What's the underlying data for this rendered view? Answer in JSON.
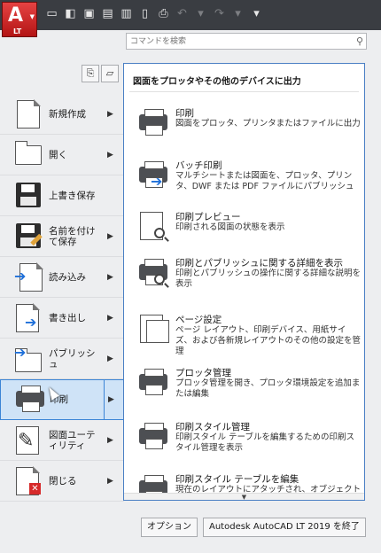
{
  "app": {
    "badge": "LT",
    "letter": "A"
  },
  "search": {
    "placeholder": "コマンドを検索"
  },
  "qat_icons": [
    "new-icon",
    "open-icon",
    "save-icon",
    "saveas-icon",
    "import-icon",
    "mobile-icon",
    "print-icon",
    "undo-icon",
    "redo-icon",
    "dropdown-icon"
  ],
  "left_menu": [
    {
      "label": "新規作成",
      "has_arrow": true
    },
    {
      "label": "開く",
      "has_arrow": true
    },
    {
      "label": "上書き保存",
      "has_arrow": false
    },
    {
      "label": "名前を付けて保存",
      "has_arrow": true
    },
    {
      "label": "読み込み",
      "has_arrow": true
    },
    {
      "label": "書き出し",
      "has_arrow": true
    },
    {
      "label": "パブリッシュ",
      "has_arrow": true
    },
    {
      "label": "印刷",
      "has_arrow": true,
      "active": true
    },
    {
      "label": "図面ユーティリティ",
      "has_arrow": true
    },
    {
      "label": "閉じる",
      "has_arrow": true
    }
  ],
  "submenu": {
    "header": "図面をプロッタやその他のデバイスに出力",
    "items": [
      {
        "title": "印刷",
        "desc": "図面をプロッタ、プリンタまたはファイルに出力"
      },
      {
        "title": "バッチ印刷",
        "desc": "マルチシートまたは図面を、プロッタ、プリンタ、DWF または PDF ファイルにパブリッシュ"
      },
      {
        "title": "印刷プレビュー",
        "desc": "印刷される図面の状態を表示"
      },
      {
        "title": "印刷とパブリッシュに関する詳細を表示",
        "desc": "印刷とパブリッシュの操作に関する詳細な説明を表示"
      },
      {
        "title": "ページ設定",
        "desc": "ページ レイアウト、印刷デバイス、用紙サイズ、および各新規レイアウトのその他の設定を管理"
      },
      {
        "title": "プロッタ管理",
        "desc": "プロッタ管理を開き、プロッタ環境設定を追加または編集"
      },
      {
        "title": "印刷スタイル管理",
        "desc": "印刷スタイル テーブルを編集するための印刷スタイル管理を表示"
      },
      {
        "title": "印刷スタイル テーブルを編集",
        "desc": "現在のレイアウトにアタッチされ、オブジェクトに"
      }
    ]
  },
  "bottom": {
    "options_label": "オプション",
    "exit_label": "Autodesk AutoCAD LT 2019 を終了"
  }
}
